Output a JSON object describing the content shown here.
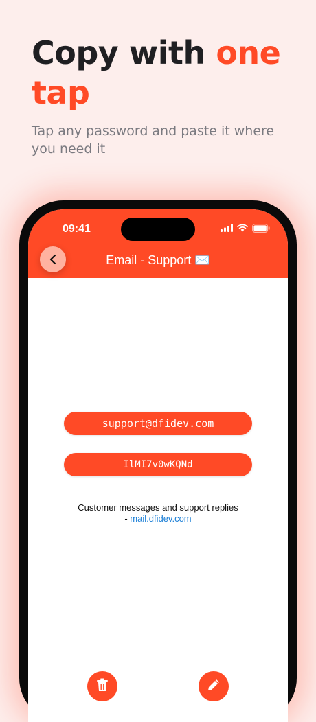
{
  "headline": {
    "part1": "Copy with ",
    "accent": "one",
    "part2": "tap"
  },
  "subhead": "Tap any password and paste it where you need it",
  "phone": {
    "status": {
      "time": "09:41"
    },
    "nav": {
      "title": "Email - Support ✉️"
    },
    "entry": {
      "username": "support@dfidev.com",
      "password": "IlMI7v0wKQNd",
      "note_text": "Customer messages and support replies - ",
      "note_link": "mail.dfidev.com"
    },
    "actions": {
      "delete_icon": "trash-icon",
      "edit_icon": "pencil-icon"
    }
  },
  "colors": {
    "accent": "#ff4a26",
    "background": "#fdeeec",
    "link": "#1a7ed6"
  }
}
